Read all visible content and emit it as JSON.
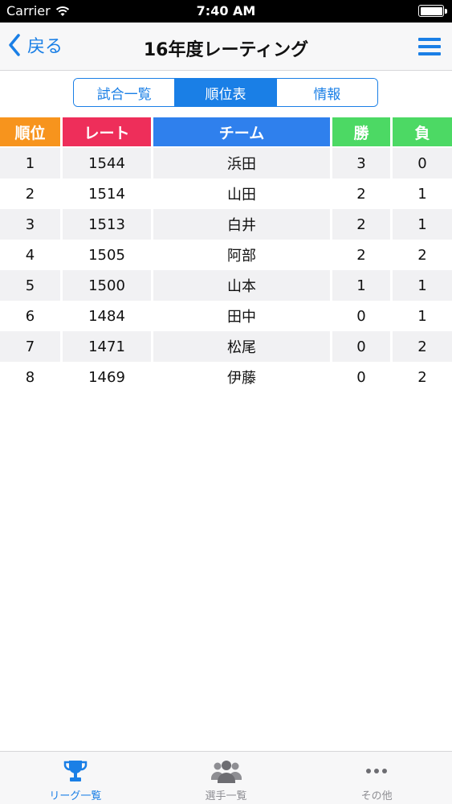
{
  "status_bar": {
    "carrier": "Carrier",
    "time": "7:40 AM"
  },
  "nav": {
    "back_label": "戻る",
    "title": "16年度レーティング"
  },
  "segments": [
    {
      "label": "試合一覧",
      "active": false
    },
    {
      "label": "順位表",
      "active": true
    },
    {
      "label": "情報",
      "active": false
    }
  ],
  "table": {
    "headers": [
      "順位",
      "レート",
      "チーム",
      "勝",
      "負"
    ],
    "rows": [
      [
        "1",
        "1544",
        "浜田",
        "3",
        "0"
      ],
      [
        "2",
        "1514",
        "山田",
        "2",
        "1"
      ],
      [
        "3",
        "1513",
        "白井",
        "2",
        "1"
      ],
      [
        "4",
        "1505",
        "阿部",
        "2",
        "2"
      ],
      [
        "5",
        "1500",
        "山本",
        "1",
        "1"
      ],
      [
        "6",
        "1484",
        "田中",
        "0",
        "1"
      ],
      [
        "7",
        "1471",
        "松尾",
        "0",
        "2"
      ],
      [
        "8",
        "1469",
        "伊藤",
        "0",
        "2"
      ]
    ]
  },
  "tabbar": [
    {
      "label": "リーグ一覧",
      "icon": "trophy-icon",
      "active": true
    },
    {
      "label": "選手一覧",
      "icon": "users-icon",
      "active": false
    },
    {
      "label": "その他",
      "icon": "more-icon",
      "active": false
    }
  ],
  "colors": {
    "accent": "#1a7fe6",
    "header_rank": "#f7941d",
    "header_rate": "#ee2e5a",
    "header_team": "#2f80ed",
    "header_win": "#4cd964",
    "header_loss": "#4cd964"
  }
}
